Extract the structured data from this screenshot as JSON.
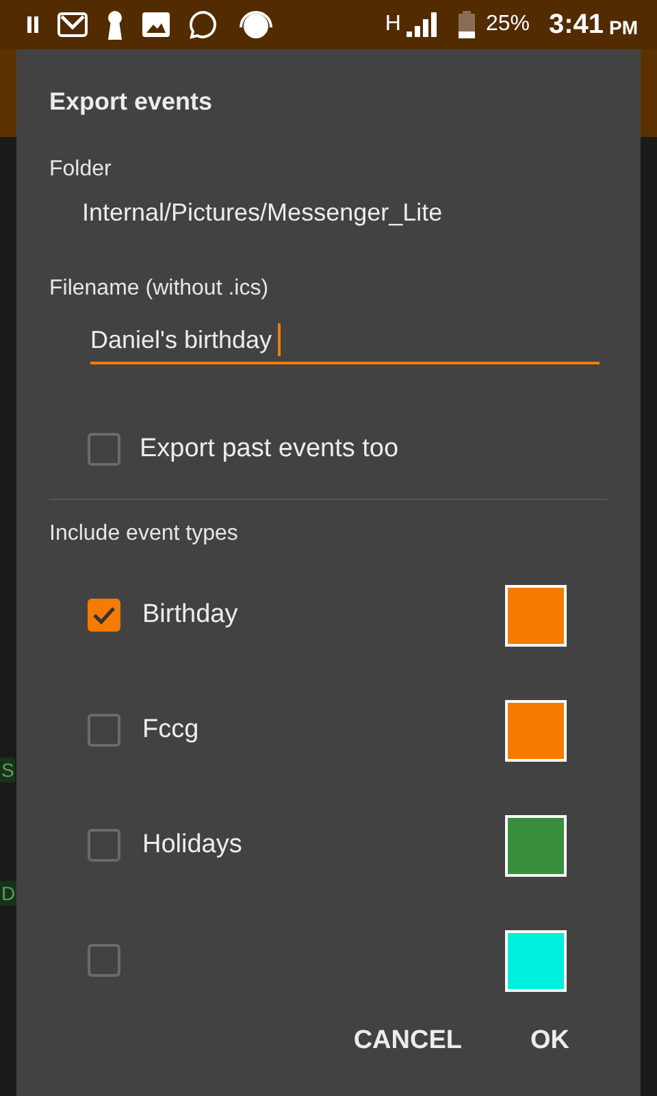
{
  "status_bar": {
    "network": "H",
    "battery": "25%",
    "time": "3:41",
    "ampm": "PM"
  },
  "background_tags": [
    {
      "label": "S"
    },
    {
      "label": "D"
    }
  ],
  "dialog": {
    "title": "Export events",
    "folder": {
      "label": "Folder",
      "value": "Internal/Pictures/Messenger_Lite"
    },
    "filename": {
      "label": "Filename (without .ics)",
      "value": "Daniel's birthday"
    },
    "past_events": {
      "label": "Export past events too",
      "checked": false
    },
    "event_types_label": "Include event types",
    "event_types": [
      {
        "label": "Birthday",
        "checked": true,
        "color": "#f57c00"
      },
      {
        "label": "Fccg",
        "checked": false,
        "color": "#f57c00"
      },
      {
        "label": "Holidays",
        "checked": false,
        "color": "#388e3c"
      },
      {
        "checked": false,
        "color": "#00f0e0"
      }
    ],
    "buttons": [
      "CANCEL",
      "OK"
    ]
  }
}
